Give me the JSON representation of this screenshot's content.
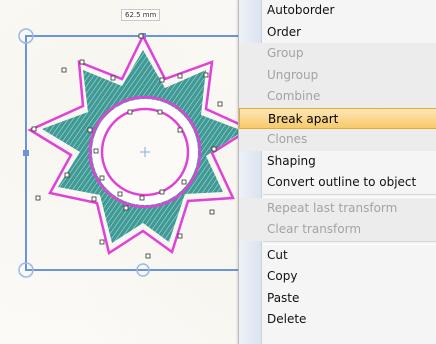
{
  "dimension_label": "62.5 mm",
  "colors": {
    "selection": "#6b95d8",
    "outline": "#e041d6",
    "fill": "#3f9a96",
    "highlight": "#f8c96a",
    "disabled_text": "#a3a3a3"
  },
  "context_menu": {
    "items": [
      {
        "label": "Autoborder",
        "state": "enabled"
      },
      {
        "label": "Order",
        "state": "enabled"
      },
      {
        "label": "Group",
        "state": "disabled"
      },
      {
        "label": "Ungroup",
        "state": "disabled"
      },
      {
        "label": "Combine",
        "state": "disabled"
      },
      {
        "label": "Break apart",
        "state": "highlighted"
      },
      {
        "label": "Clones",
        "state": "disabled"
      },
      {
        "label": "Shaping",
        "state": "enabled"
      },
      {
        "label": "Convert outline to object",
        "state": "enabled"
      },
      {
        "label": "Repeat last transform",
        "state": "disabled"
      },
      {
        "label": "Clear transform",
        "state": "disabled"
      },
      {
        "label": "Cut",
        "state": "enabled"
      },
      {
        "label": "Copy",
        "state": "enabled"
      },
      {
        "label": "Paste",
        "state": "enabled"
      },
      {
        "label": "Delete",
        "state": "enabled"
      }
    ]
  }
}
